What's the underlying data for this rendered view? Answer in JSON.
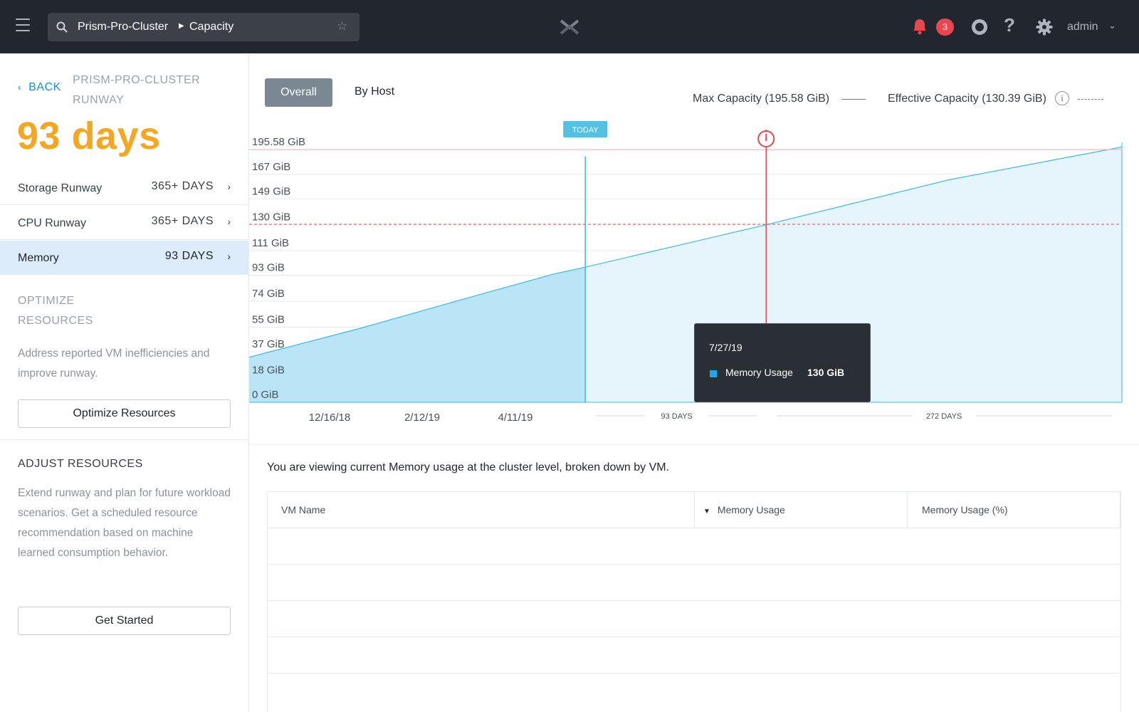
{
  "topbar": {
    "breadcrumb_cluster": "Prism-Pro-Cluster",
    "breadcrumb_page": "Capacity",
    "alert_count": "3",
    "user": "admin"
  },
  "sidebar": {
    "back_label": "BACK",
    "cluster_title": "PRISM-PRO-CLUSTER RUNWAY",
    "runway_days": "93 days",
    "runways": [
      {
        "label": "Storage Runway",
        "value": "365+ DAYS"
      },
      {
        "label": "CPU Runway",
        "value": "365+ DAYS"
      },
      {
        "label": "Memory",
        "value": "93 DAYS"
      }
    ],
    "optimize": {
      "title": "OPTIMIZE RESOURCES",
      "text": "Address reported VM inefficiencies and improve runway.",
      "button": "Optimize Resources"
    },
    "adjust": {
      "title": "ADJUST RESOURCES",
      "text": "Extend runway and plan for future workload scenarios. Get a scheduled resource recommendation based on machine learned consumption behavior.",
      "button": "Get Started"
    }
  },
  "main": {
    "tabs": [
      "Overall",
      "By Host"
    ],
    "legend_max": "Max Capacity (195.58 GiB)",
    "legend_effective": "Effective Capacity (130.39 GiB)",
    "info_glyph": "i",
    "viewing_text": "You are viewing current Memory usage at the cluster level, broken down by VM.",
    "table_headers": [
      "VM Name",
      "Memory Usage",
      "Memory Usage (%)"
    ]
  },
  "tooltip": {
    "date": "7/27/19",
    "series": "Memory Usage",
    "value": "130 GiB"
  },
  "chart_data": {
    "type": "area",
    "title": "",
    "y_axis_labels": [
      "0 GiB",
      "18 GiB",
      "37 GiB",
      "55 GiB",
      "74 GiB",
      "93 GiB",
      "111 GiB",
      "130 GiB",
      "149 GiB",
      "167 GiB"
    ],
    "y_ticks": [
      0,
      18,
      37,
      55,
      74,
      93,
      111,
      130,
      149,
      167
    ],
    "ylim": [
      0,
      195.58
    ],
    "x_axis_labels": [
      "12/16/18",
      "2/12/19",
      "4/11/19"
    ],
    "max_capacity": 195.58,
    "max_capacity_label": "195.58 GiB",
    "effective_capacity": 130.39,
    "today_label": "TODAY",
    "ranges": [
      {
        "label": "93 DAYS"
      },
      {
        "label": "272 DAYS"
      }
    ],
    "series": [
      {
        "name": "Memory Usage",
        "role": "historical",
        "x": [
          "2018-11-06",
          "2019-01-01",
          "2019-03-01",
          "2019-04-10",
          "2019-04-26"
        ],
        "y": [
          33,
          54,
          78,
          94,
          99
        ]
      },
      {
        "name": "Memory Usage",
        "role": "forecast",
        "x": [
          "2019-04-26",
          "2019-07-27",
          "2019-10-28",
          "2020-01-24"
        ],
        "y": [
          99,
          130,
          163,
          187
        ]
      }
    ],
    "today": "2019-04-26",
    "runway_end": "2019-07-27",
    "colors": {
      "historical_fill": "#b9e5f7",
      "forecast_fill": "#e6f5fc",
      "line": "#3cb8e6",
      "max_line": "#e8474f",
      "today_line": "#3fb6dd",
      "runway_line": "#e8474f"
    }
  }
}
